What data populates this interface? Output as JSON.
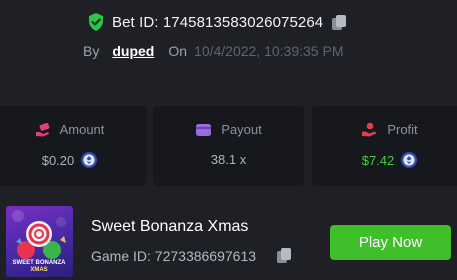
{
  "bet": {
    "id_label": "Bet ID: 1745813583026075264",
    "by_label": "By",
    "user": "duped",
    "on_label": "On",
    "date": "10/4/2022, 10:39:35 PM"
  },
  "stats": [
    {
      "label": "Amount",
      "value": "$0.20",
      "icon": "money-hand-icon",
      "coin": true
    },
    {
      "label": "Payout",
      "value": "38.1 x",
      "icon": "wallet-icon",
      "coin": false
    },
    {
      "label": "Profit",
      "value": "$7.42",
      "icon": "profit-hand-icon",
      "coin": true
    }
  ],
  "game": {
    "title": "Sweet Bonanza Xmas",
    "id_label": "Game ID: 7273386697613",
    "play_label": "Play Now",
    "thumb_text_1": "SWEET BONANZA",
    "thumb_text_2": "XMAS"
  },
  "colors": {
    "background": "#1e2026",
    "card": "#16181d",
    "accent_green": "#3fbf2a",
    "profit_green": "#3fd13f",
    "icon_pink": "#e0407a",
    "icon_purple": "#9b6ce0",
    "icon_red": "#e23d4b"
  }
}
